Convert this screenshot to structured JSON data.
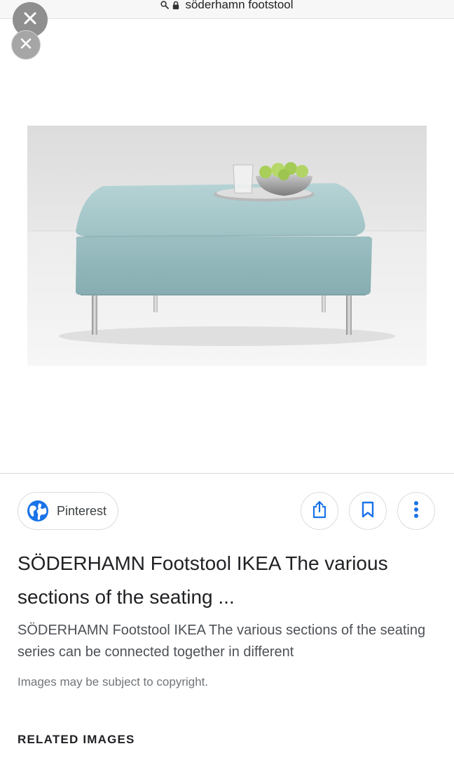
{
  "browser": {
    "url": "söderhamn footstool",
    "search_icon": "search-icon",
    "lock_icon": "lock-icon"
  },
  "overlay": {
    "close_icon": "close-icon",
    "close_color": "#8f8f8f"
  },
  "result": {
    "source": {
      "label": "Pinterest",
      "icon": "globe-icon",
      "icon_color": "#1a73e8"
    },
    "actions": {
      "share_icon": "share-icon",
      "save_icon": "bookmark-icon",
      "more_icon": "more-vertical-icon",
      "accent": "#1a73e8"
    },
    "title": "SÖDERHAMN Footstool IKEA The various sections of the seating ...",
    "description": "SÖDERHAMN Footstool IKEA The various sections of the seating series can be connected together in different",
    "copyright": "Images may be subject to copyright."
  },
  "related": {
    "heading": "RELATED IMAGES"
  }
}
